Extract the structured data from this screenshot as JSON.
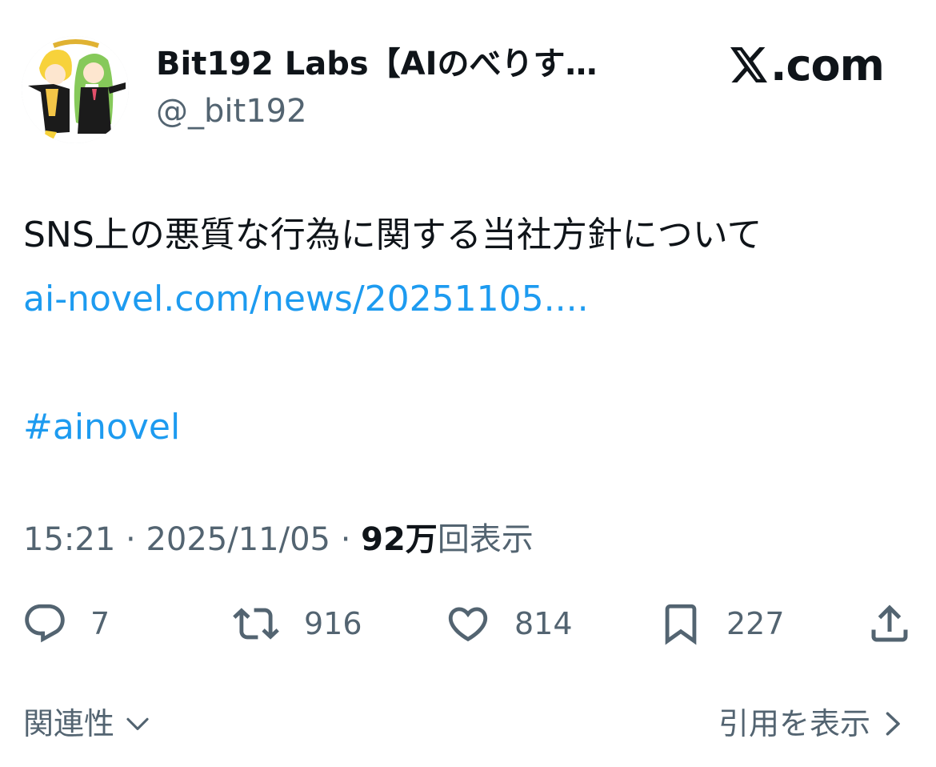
{
  "author": {
    "display_name": "Bit192 Labs【AIのべりす…",
    "handle": "@_bit192",
    "avatar_icon": "anime-characters-avatar"
  },
  "brand": {
    "logo_text": ".com",
    "logo_icon": "x-logo-icon"
  },
  "tweet": {
    "text": "SNS上の悪質な行為に関する当社方針について",
    "link": "ai-novel.com/news/20251105....",
    "hashtag": "#ainovel"
  },
  "meta": {
    "time": "15:21",
    "separator": " · ",
    "date": "2025/11/05",
    "views_count": "92万",
    "views_label": "回表示"
  },
  "actions": {
    "reply_count": "7",
    "retweet_count": "916",
    "like_count": "814",
    "bookmark_count": "227"
  },
  "footer": {
    "related_label": "関連性",
    "quotes_label": "引用を表示"
  },
  "colors": {
    "text_primary": "#0f1419",
    "text_secondary": "#536471",
    "link": "#1d9bf0",
    "background": "#ffffff"
  }
}
